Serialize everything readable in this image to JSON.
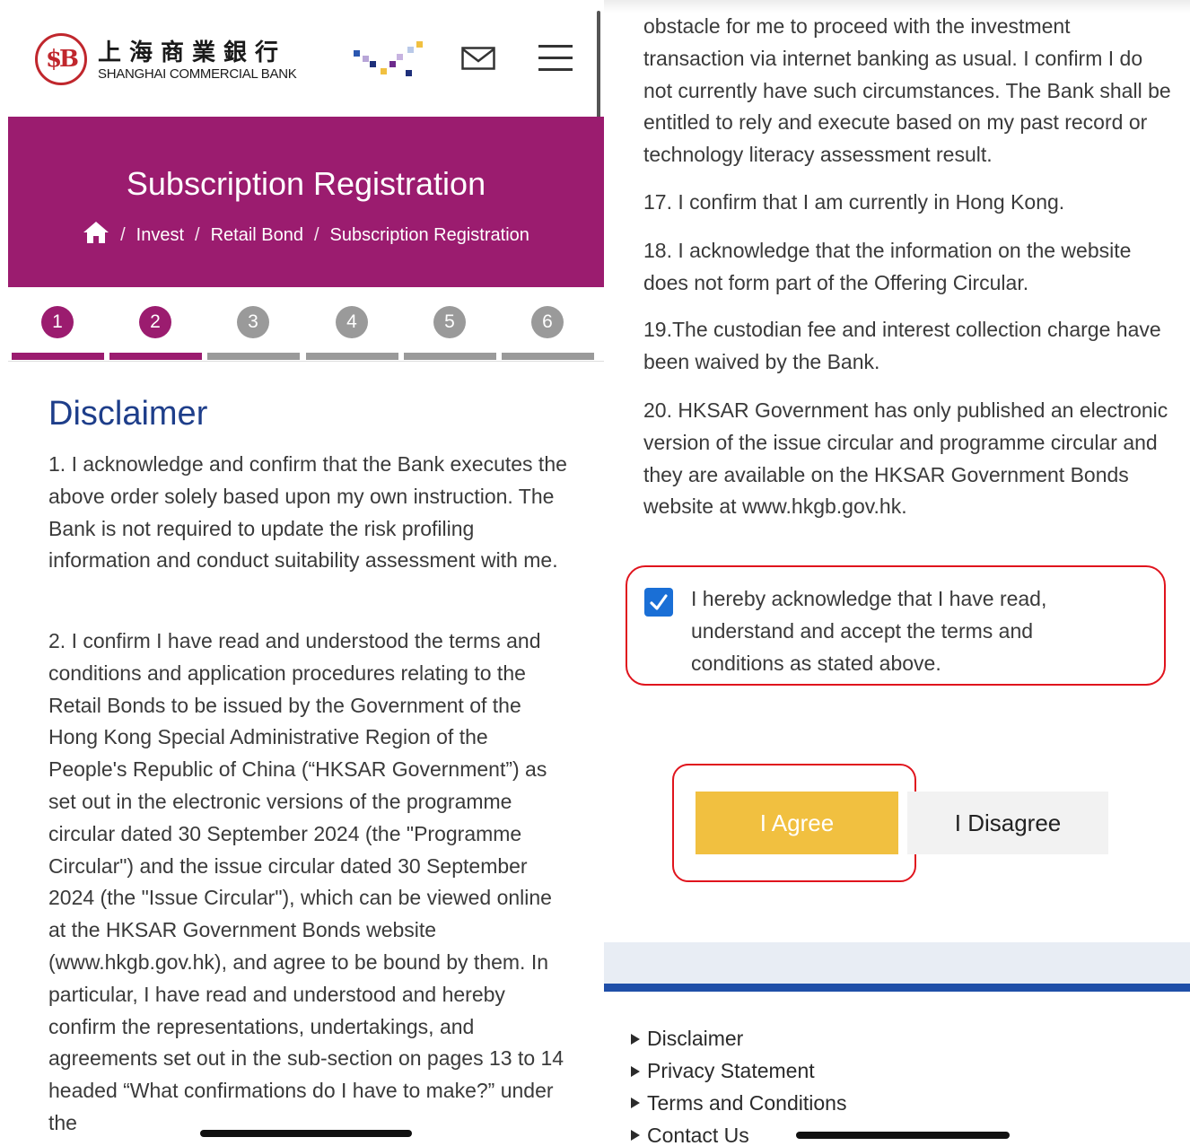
{
  "header": {
    "logo_seal": "$B",
    "logo_chinese": "上海商業銀行",
    "logo_english": "SHANGHAI COMMERCIAL BANK"
  },
  "hero": {
    "title": "Subscription Registration",
    "breadcrumb": [
      "Invest",
      "Retail Bond",
      "Subscription Registration"
    ],
    "separator": "/"
  },
  "steps": [
    {
      "num": "1",
      "active": true
    },
    {
      "num": "2",
      "active": true
    },
    {
      "num": "3",
      "active": false
    },
    {
      "num": "4",
      "active": false
    },
    {
      "num": "5",
      "active": false
    },
    {
      "num": "6",
      "active": false
    }
  ],
  "colors": {
    "brand_purple": "#9b1c6f",
    "step_inactive": "#9a9a9a",
    "title_blue": "#1e3e8a",
    "agree_yellow": "#f1c040",
    "highlight_red": "#e0141d",
    "checkbox_blue": "#1a6fd6",
    "footer_blue": "#1f4fa8"
  },
  "disclaimer": {
    "title": "Disclaimer",
    "p1": "1. I acknowledge and confirm that the Bank executes the above order solely based upon my own instruction. The Bank is not required to update the risk profiling information and conduct suitability assessment with me.",
    "p2": "2. I confirm I have read and understood the terms and conditions and application procedures relating to the Retail Bonds to be issued by the Government of the Hong Kong Special Administrative Region of the People's Republic of China (“HKSAR Government”) as set out in the electronic versions of the programme circular dated 30 September 2024 (the \"Programme Circular\") and the issue circular dated 30 September 2024 (the \"Issue Circular\"), which can be viewed online at the HKSAR Government Bonds website (www.hkgb.gov.hk), and agree to be bound by them. In particular, I have read and understood and hereby confirm the representations, undertakings, and agreements set out in the sub-section on pages 13 to 14 headed “What confirmations do I have to make?” under the",
    "p16_tail": "obstacle for me to proceed with the investment transaction via internet banking as usual. I confirm I do not currently have such circumstances. The Bank shall be entitled to rely and execute based on my past record or technology literacy assessment result.",
    "p17": "17. I confirm that I am currently in Hong Kong.",
    "p18": "18. I acknowledge that the information on the website does not form part of the Offering Circular.",
    "p19": "19.The custodian fee and interest collection charge have been waived by the Bank.",
    "p20": "20. HKSAR Government has only published an electronic version of the issue circular and programme circular and they are available on the HKSAR Government Bonds website at www.hkgb.gov.hk."
  },
  "acknowledge": {
    "checked": true,
    "text": "I hereby acknowledge that I have read, understand and accept the terms and conditions as stated above."
  },
  "buttons": {
    "agree": "I Agree",
    "disagree": "I Disagree"
  },
  "footer": {
    "links": [
      "Disclaimer",
      "Privacy Statement",
      "Terms and Conditions",
      "Contact Us"
    ]
  }
}
